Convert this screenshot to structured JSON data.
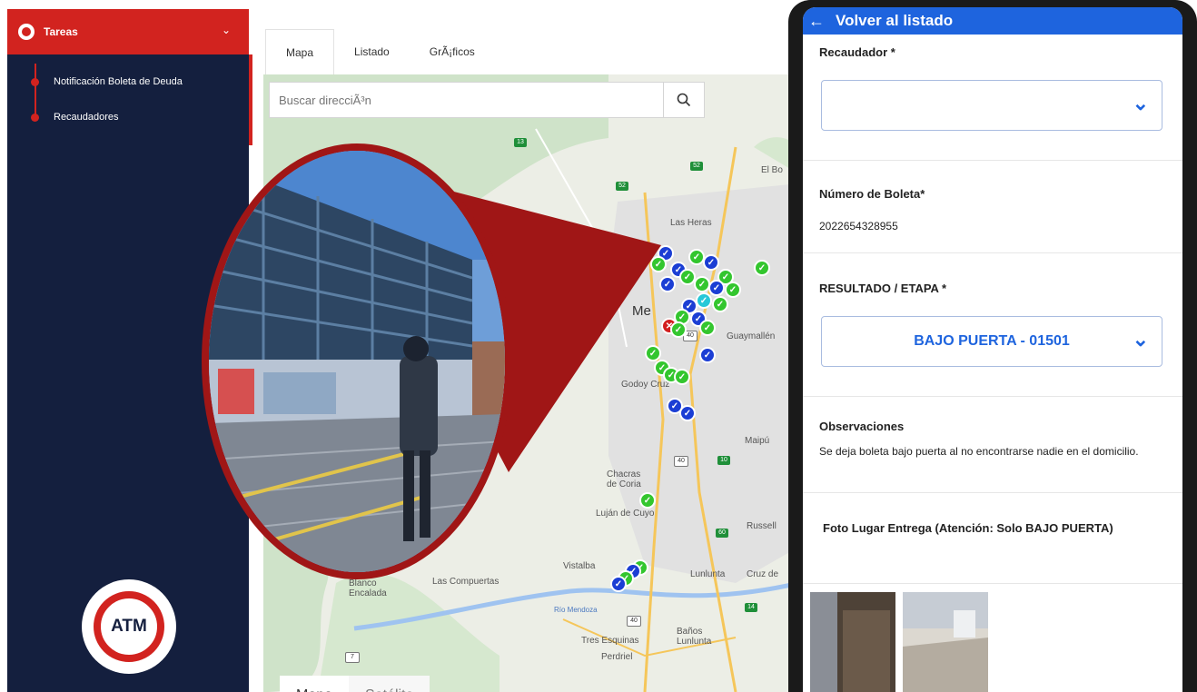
{
  "sidebar": {
    "header_label": "Tareas",
    "items": [
      {
        "label": "Notificación Boleta de Deuda"
      },
      {
        "label": "Recaudadores"
      }
    ],
    "logo_text": "ATM"
  },
  "map_panel": {
    "tabs": [
      {
        "label": "Mapa",
        "active": true
      },
      {
        "label": "Listado",
        "active": false
      },
      {
        "label": "GrÃ¡ficos",
        "active": false
      }
    ],
    "search_placeholder": "Buscar direcciÃ³n",
    "search_icon": "search-icon",
    "place_labels": [
      "El Bo",
      "Las Heras",
      "Me",
      "Guaymallén",
      "Godoy Cruz",
      "Maipú",
      "Chacras de Coria",
      "Luján de Cuyo",
      "Russell",
      "Vistalba",
      "Lunlunta",
      "Cruz de",
      "Blanco Encalada",
      "Las Compuertas",
      "Río Mendoza",
      "Tres Esquinas",
      "Perdriel",
      "Baños Lunlunta"
    ],
    "route_shields": [
      "13",
      "52",
      "52",
      "40",
      "40",
      "10",
      "60",
      "14",
      "40",
      "7"
    ],
    "bottom_tabs": [
      {
        "label": "Mapa"
      },
      {
        "label": "Satélite"
      }
    ]
  },
  "phone": {
    "appbar_title": "Volver al listado",
    "recaudador_label": "Recaudador *",
    "numero_label": "Número de Boleta*",
    "numero_value": "2022654328955",
    "resultado_label": "RESULTADO / ETAPA *",
    "resultado_value": "BAJO PUERTA - 01501",
    "observaciones_label": "Observaciones",
    "observaciones_text": "Se deja boleta bajo puerta al no encontrarse nadie en el domicilio.",
    "foto_label": "Foto Lugar Entrega (Atención: Solo BAJO PUERTA)"
  },
  "colors": {
    "brand_red": "#d2231f",
    "sidebar_navy": "#141f3e",
    "app_blue": "#1e64de",
    "marker_green": "#33c62e",
    "marker_blue": "#1b3ed4"
  }
}
